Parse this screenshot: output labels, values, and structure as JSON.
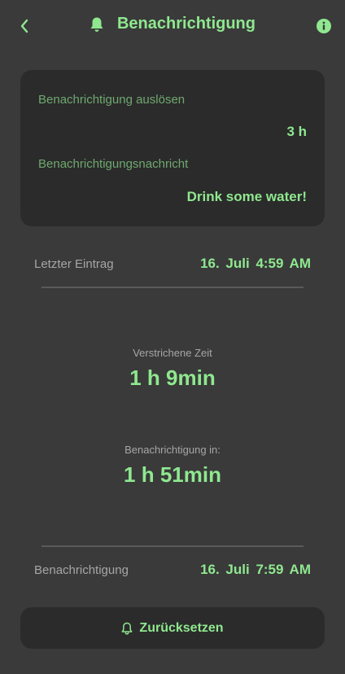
{
  "header": {
    "title": "Benachrichtigung",
    "back_icon": "chevron-left-icon",
    "bell_icon": "bell-icon",
    "info_icon": "info-icon"
  },
  "settings_card": {
    "trigger_label": "Benachrichtigung auslösen",
    "trigger_value": "3 h",
    "message_label": "Benachrichtigungsnachricht",
    "message_value": "Drink some water!"
  },
  "last_entry": {
    "label": "Letzter Eintrag",
    "value": "16. Juli  4:59 AM"
  },
  "elapsed": {
    "label": "Verstrichene Zeit",
    "value": "1 h 9min"
  },
  "next_notification": {
    "label": "Benachrichtigung in:",
    "value": "1 h 51min"
  },
  "notification_time": {
    "label": "Benachrichtigung",
    "value": "16. Juli  7:59 AM"
  },
  "reset_button": {
    "label": "Zurücksetzen",
    "icon": "bell-outline-icon"
  },
  "colors": {
    "background": "#3a3a3a",
    "card": "#2b2b2b",
    "accent": "#8fe88f",
    "muted_accent": "#6fa86f",
    "muted_text": "#a6a6a6"
  }
}
